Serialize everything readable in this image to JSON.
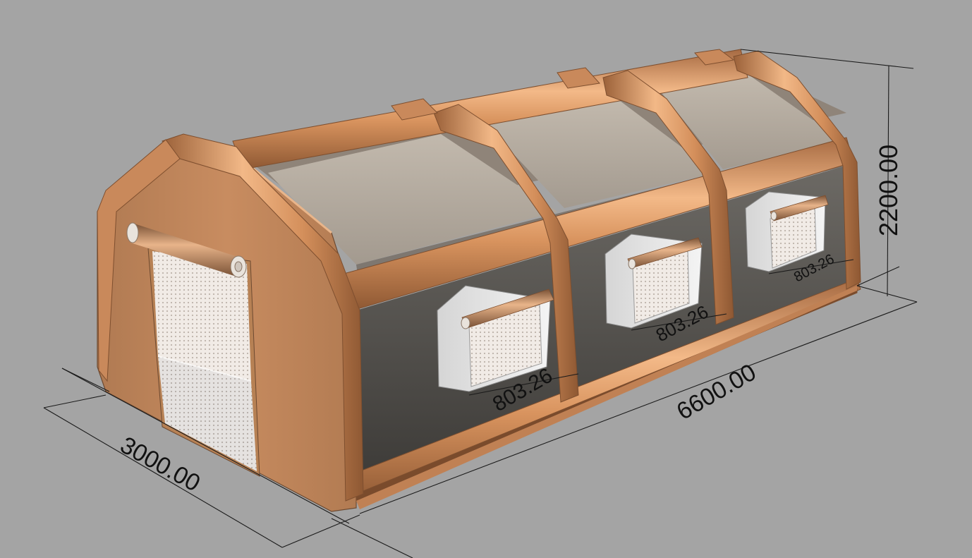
{
  "diagram": {
    "dimensions": {
      "height": "2200.00",
      "length": "6600.00",
      "width": "3000.00",
      "window_1": "803.26",
      "window_2": "803.26",
      "window_3": "803.26"
    },
    "colors": {
      "background": "#a4a4a4",
      "tube": "#d6925f",
      "tube_highlight": "#f3b988",
      "tube_shadow": "#9b6139",
      "end_wall": "#c78a5e",
      "roof_panel": "#b5aca1",
      "interior": "#4a4845",
      "filter_box": "#e6e6e6",
      "mesh": "#efe9e4"
    }
  }
}
